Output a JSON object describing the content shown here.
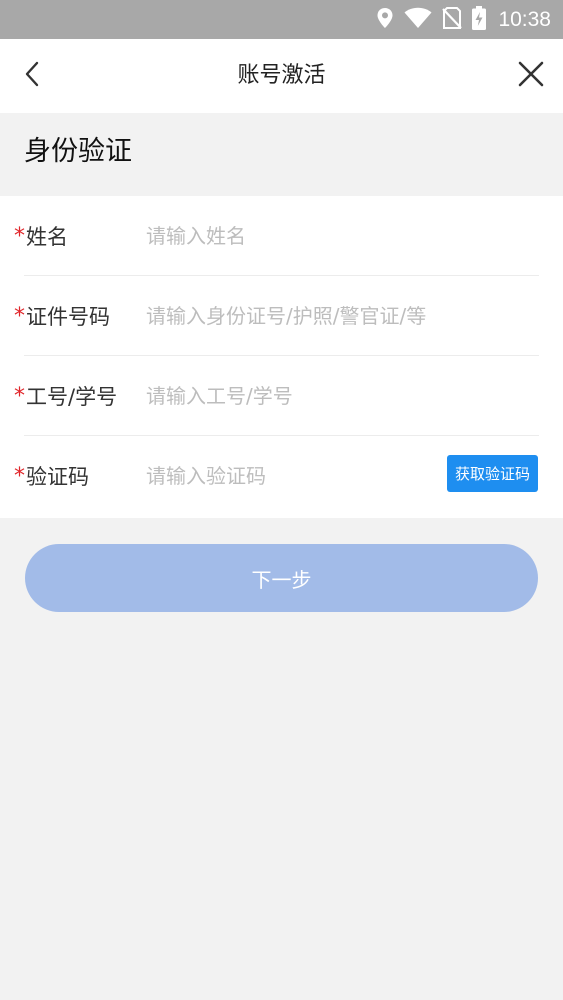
{
  "status_bar": {
    "time": "10:38",
    "icons": [
      "location-icon",
      "wifi-icon",
      "no-sim-icon",
      "battery-charging-icon"
    ]
  },
  "nav": {
    "title": "账号激活",
    "back_icon": "chevron-left-icon",
    "close_icon": "close-icon"
  },
  "section": {
    "title": "身份验证"
  },
  "form": {
    "required_mark": "*",
    "fields": [
      {
        "label": "姓名",
        "value": "",
        "placeholder": "请输入姓名"
      },
      {
        "label": "证件号码",
        "value": "",
        "placeholder": "请输入身份证号/护照/警官证/等"
      },
      {
        "label": "工号/学号",
        "value": "",
        "placeholder": "请输入工号/学号"
      },
      {
        "label": "验证码",
        "value": "",
        "placeholder": "请输入验证码"
      }
    ],
    "get_code_label": "获取验证码"
  },
  "actions": {
    "next_label": "下一步"
  },
  "colors": {
    "status_bar": "#a8a8a8",
    "required": "#e0262b",
    "code_button": "#1e8ef0",
    "next_button_disabled": "#a2bbe8",
    "background": "#f2f2f2"
  }
}
